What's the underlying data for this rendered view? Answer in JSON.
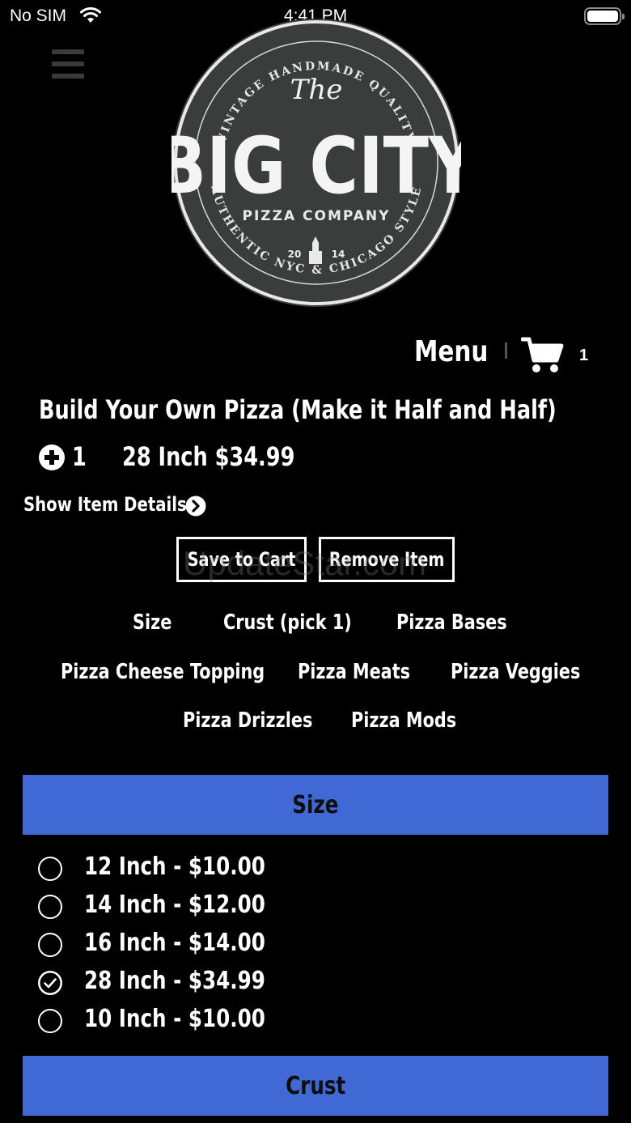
{
  "status_bar": {
    "carrier": "No SIM",
    "time": "4:41 PM"
  },
  "brand": {
    "logo_text": "The BIG CITY PIZZA COMPANY",
    "logo_top_arc": "VINTAGE HANDMADE QUALITY",
    "logo_bottom_arc": "AUTHENTIC NYC & CHICAGO STYLE",
    "logo_year": "20 14"
  },
  "nav": {
    "menu_label": "Menu",
    "cart_count": "1"
  },
  "item": {
    "title": "Build Your Own Pizza (Make it Half and Half)",
    "quantity": "1",
    "selected_size_price": "28 Inch $34.99",
    "show_details_label": "Show Item Details"
  },
  "actions": {
    "save_label": "Save to Cart",
    "remove_label": "Remove Item"
  },
  "watermark": "UpdateStar.com",
  "categories": [
    "Size",
    "Crust (pick 1)",
    "Pizza Bases",
    "Pizza Cheese Topping",
    "Pizza Meats",
    "Pizza Veggies",
    "Pizza Drizzles",
    "Pizza Mods"
  ],
  "sections": {
    "size": {
      "header": "Size",
      "options": [
        {
          "label": "12 Inch - $10.00",
          "selected": false
        },
        {
          "label": "14 Inch - $12.00",
          "selected": false
        },
        {
          "label": "16 Inch - $14.00",
          "selected": false
        },
        {
          "label": "28 Inch - $34.99",
          "selected": true
        },
        {
          "label": "10 Inch - $10.00",
          "selected": false
        }
      ]
    },
    "crust": {
      "header": "Crust"
    }
  },
  "colors": {
    "background": "#000000",
    "section_header": "#4169d6",
    "text": "#ffffff"
  }
}
